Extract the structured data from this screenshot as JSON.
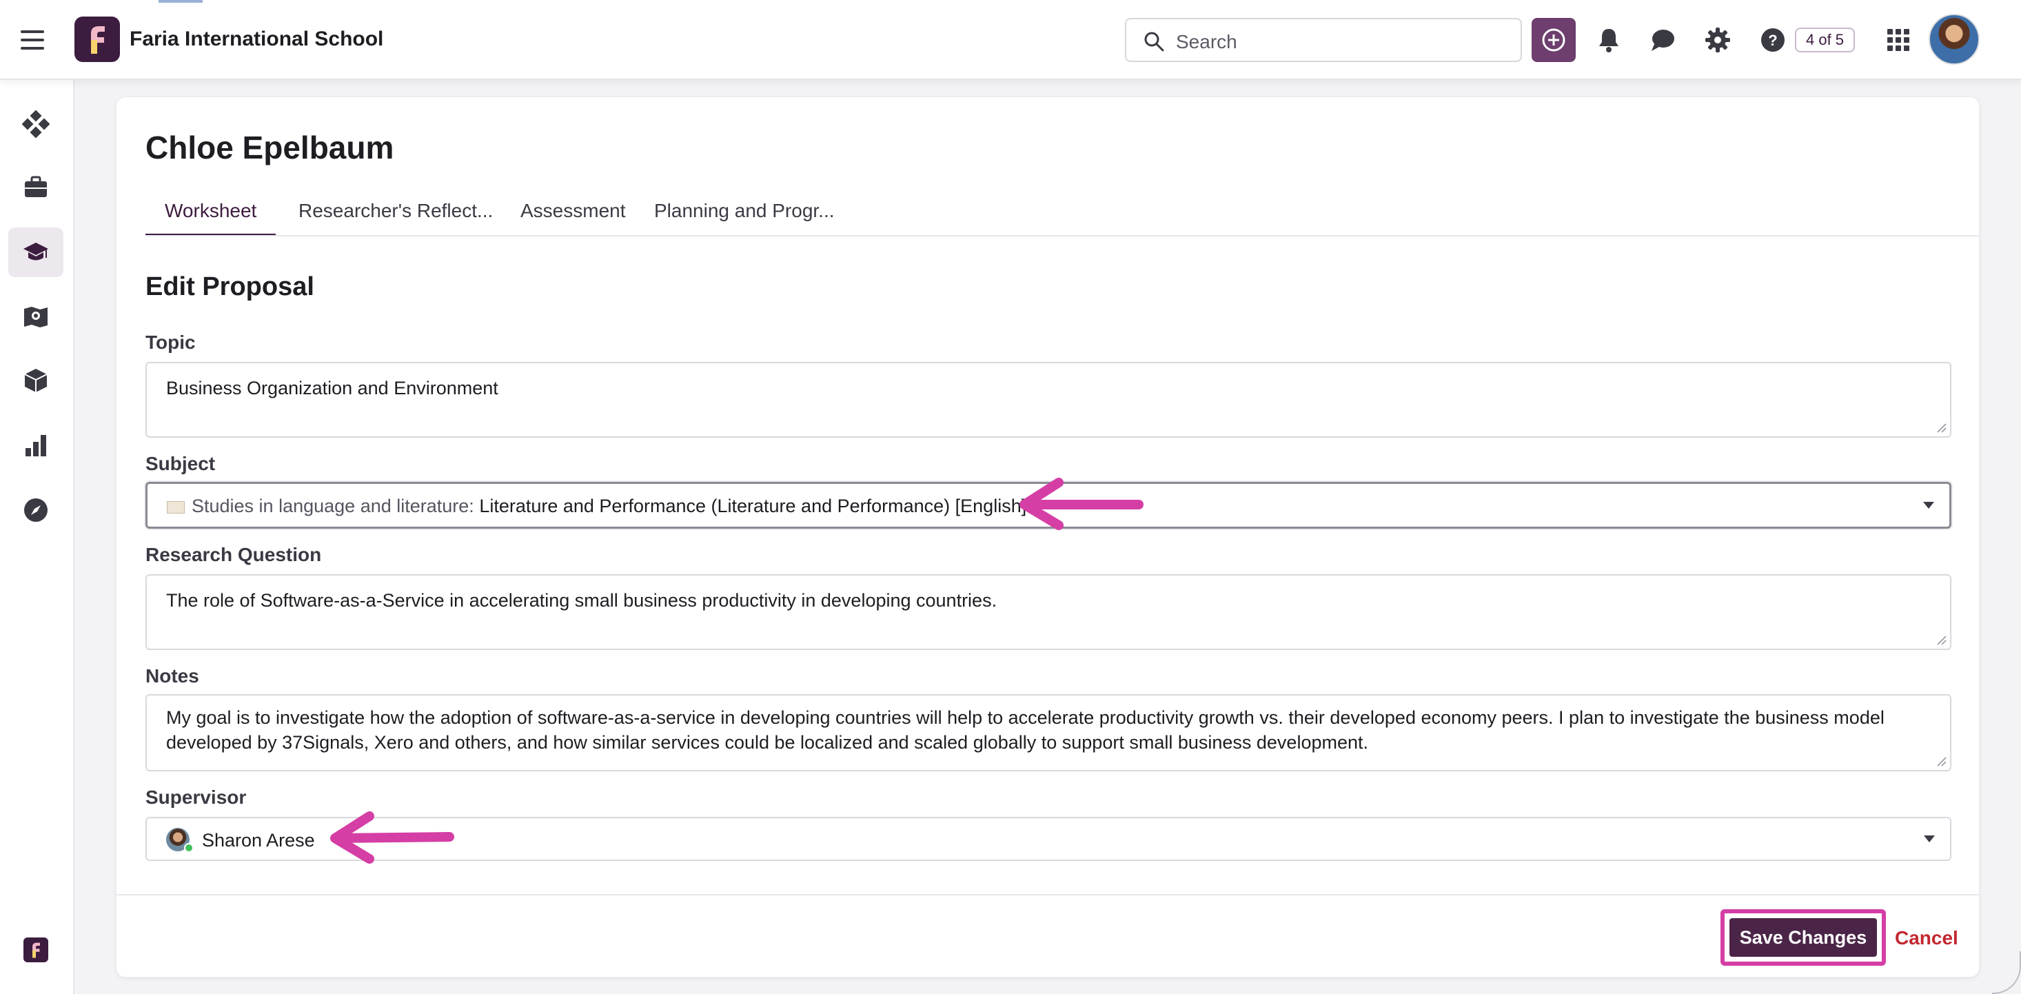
{
  "header": {
    "school_name": "Faria International School",
    "search_placeholder": "Search",
    "count_badge": "4 of 5"
  },
  "icons": {
    "top": [
      "plus-circle-icon",
      "bell-icon",
      "chat-bubble-icon",
      "gear-icon",
      "help-icon",
      "apps-grid-icon"
    ],
    "sidebar": [
      "dashboard-icon",
      "briefcase-icon",
      "graduation-cap-icon",
      "map-icon",
      "cube-icon",
      "bar-chart-icon",
      "compass-icon"
    ]
  },
  "page": {
    "student_name": "Chloe Epelbaum",
    "tabs": [
      {
        "label": "Worksheet",
        "active": true
      },
      {
        "label": "Researcher's Reflect..."
      },
      {
        "label": "Assessment"
      },
      {
        "label": "Planning and Progr..."
      }
    ],
    "section_title": "Edit Proposal"
  },
  "form": {
    "topic": {
      "label": "Topic",
      "value": "Business Organization and Environment"
    },
    "subject": {
      "label": "Subject",
      "prefix": "Studies in language and literature:",
      "value": "Literature and Performance (Literature and Performance) [English]"
    },
    "research_question": {
      "label": "Research Question",
      "value": "The role of Software-as-a-Service in accelerating small business productivity in developing countries."
    },
    "notes": {
      "label": "Notes",
      "value": "My goal is to investigate how the adoption of software-as-a-service in developing countries will help to accelerate productivity growth vs. their developed economy peers. I plan to investigate the business model developed by 37Signals, Xero and others, and how similar services could be localized and scaled globally to support small business development."
    },
    "supervisor": {
      "label": "Supervisor",
      "value": "Sharon Arese"
    }
  },
  "actions": {
    "save_label": "Save Changes",
    "cancel_label": "Cancel"
  },
  "colors": {
    "brand": "#3c1c3f",
    "accent_button": "#6d3e6e",
    "save_button": "#4b2548",
    "annotation": "#d53ea5",
    "cancel": "#c2282f"
  }
}
